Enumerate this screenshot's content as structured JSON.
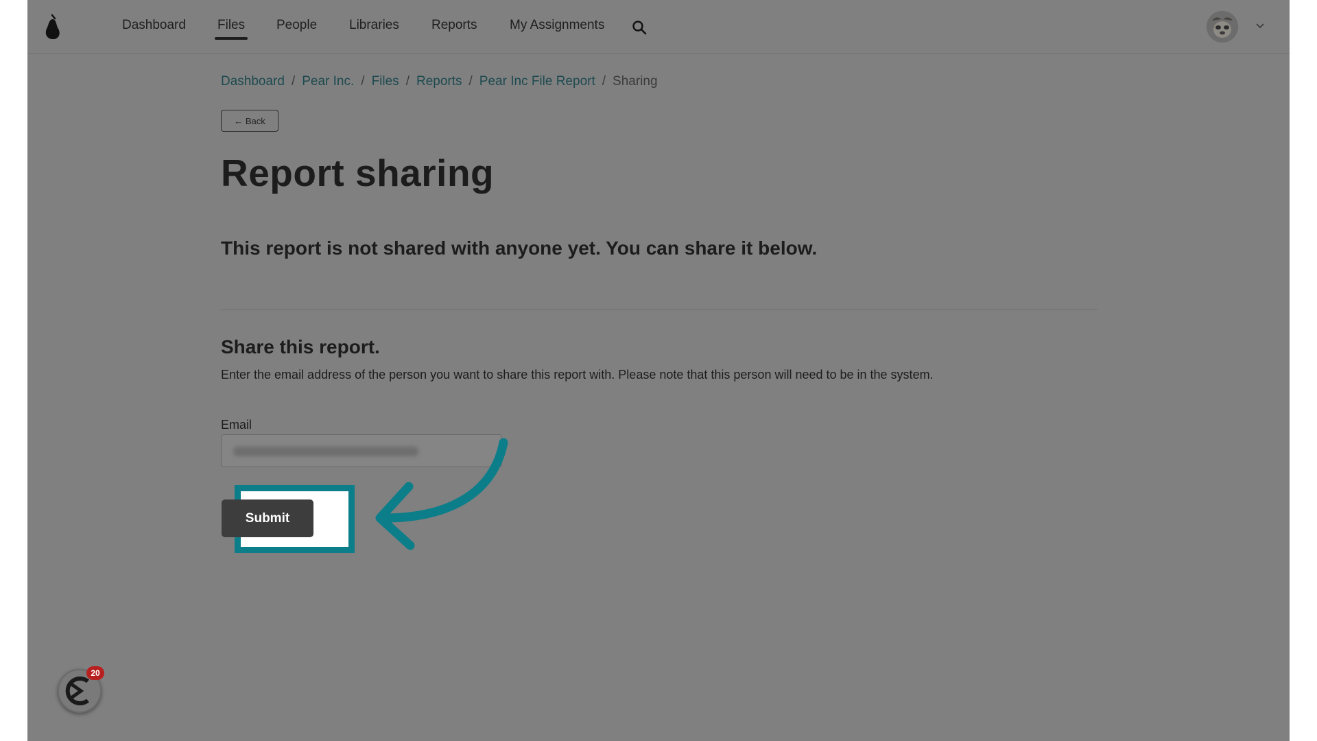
{
  "nav": {
    "items": [
      {
        "label": "Dashboard"
      },
      {
        "label": "Files",
        "active": true
      },
      {
        "label": "People"
      },
      {
        "label": "Libraries"
      },
      {
        "label": "Reports"
      },
      {
        "label": "My Assignments"
      }
    ]
  },
  "breadcrumb": {
    "items": [
      "Dashboard",
      "Pear Inc.",
      "Files",
      "Reports",
      "Pear Inc File Report"
    ],
    "current": "Sharing",
    "separator": "/"
  },
  "back_label": "← Back",
  "page_title": "Report sharing",
  "notice": "This report is not shared with anyone yet. You can share it below.",
  "share": {
    "heading": "Share this report.",
    "description": "Enter the email address of the person you want to share this report with. Please note that this person will need to be in the system.",
    "email_label": "Email",
    "email_value": "",
    "submit_label": "Submit"
  },
  "widget": {
    "badge_count": "20"
  },
  "colors": {
    "overlay": "#808080",
    "accent_teal": "#0c7e8a",
    "link": "#1d4a4f",
    "button_dark": "#3d3d3d",
    "badge_red": "#b8201f"
  },
  "icons": {
    "logo": "pear-logo-icon",
    "search": "search-icon",
    "chevron": "chevron-down-icon",
    "arrow": "curved-arrow-icon",
    "widget": "help-widget-icon"
  }
}
